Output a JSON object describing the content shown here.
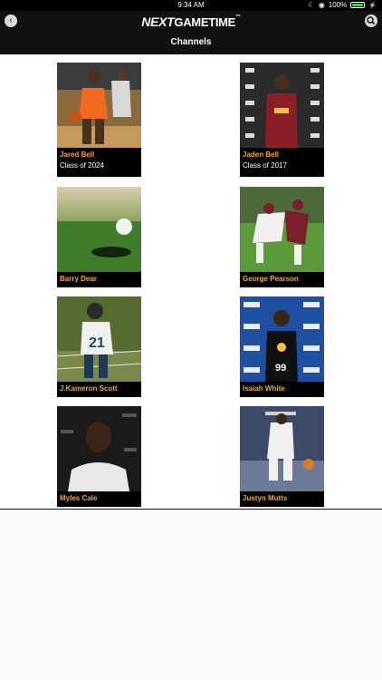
{
  "status": {
    "time": "9:34 AM",
    "battery": "100%",
    "battery_level": 1.0
  },
  "nav": {
    "back_icon": "chevron-left-icon",
    "search_icon": "search-icon",
    "logo_next": "NEXT",
    "logo_gametime": "GAMETIME",
    "logo_tm": "™",
    "title": "Channels"
  },
  "channels": [
    {
      "name": "Jared Bell",
      "subtitle": "Class of 2024"
    },
    {
      "name": "Jaden Bell",
      "subtitle": "Class of 2017"
    },
    {
      "name": "Barry Dear"
    },
    {
      "name": "George Pearson"
    },
    {
      "name": "J.Kameron Scott"
    },
    {
      "name": "Isaiah White"
    },
    {
      "name": "Myles Cale"
    },
    {
      "name": "Justyn Mutts"
    }
  ]
}
